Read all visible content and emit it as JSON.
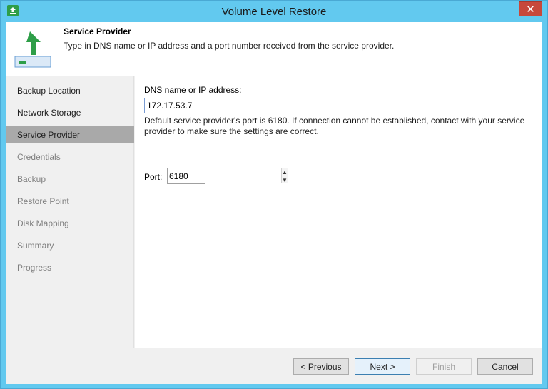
{
  "window": {
    "title": "Volume Level Restore",
    "close_glyph": "✕"
  },
  "header": {
    "title": "Service Provider",
    "description": "Type in DNS name or IP address and a port number received from the service provider.",
    "icon": "upload-arrow-icon"
  },
  "sidebar": {
    "items": [
      {
        "label": "Backup Location",
        "state": "done"
      },
      {
        "label": "Network Storage",
        "state": "done"
      },
      {
        "label": "Service Provider",
        "state": "active"
      },
      {
        "label": "Credentials",
        "state": "pending"
      },
      {
        "label": "Backup",
        "state": "pending"
      },
      {
        "label": "Restore Point",
        "state": "pending"
      },
      {
        "label": "Disk Mapping",
        "state": "pending"
      },
      {
        "label": "Summary",
        "state": "pending"
      },
      {
        "label": "Progress",
        "state": "pending"
      }
    ]
  },
  "form": {
    "dns_label": "DNS name or IP address:",
    "dns_value": "172.17.53.7",
    "note": "Default service provider's port is 6180. If connection cannot be established, contact with your service provider to make sure the settings are correct.",
    "port_label": "Port:",
    "port_value": "6180"
  },
  "buttons": {
    "previous": "< Previous",
    "next": "Next >",
    "finish": "Finish",
    "cancel": "Cancel"
  },
  "colors": {
    "accent": "#62c9ef",
    "active_step": "#a9a9a9",
    "icon_green": "#2e9e48"
  }
}
